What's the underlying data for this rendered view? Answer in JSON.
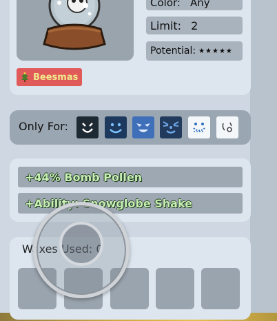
{
  "stats": {
    "color": {
      "label": "Color:",
      "value": "Any"
    },
    "limit": {
      "label": "Limit:",
      "value": "2"
    },
    "potential": {
      "label": "Potential:",
      "value": "★★★★★"
    }
  },
  "tag": {
    "label": "Beesmas",
    "color": "#e05a5a",
    "text_color": "#f0e98a"
  },
  "only_for": {
    "label": "Only For:",
    "bees": [
      {
        "name": "vicious-bee"
      },
      {
        "name": "bubble-bee"
      },
      {
        "name": "cobalt-bee"
      },
      {
        "name": "tabby-bee"
      },
      {
        "name": "festive-bee"
      },
      {
        "name": "photon-bee"
      }
    ]
  },
  "abilities": [
    "+44% Bomb Pollen",
    "+Ability: Snowglobe Shake"
  ],
  "waxes": {
    "label": "Waxes Used: 0",
    "slots": 5
  },
  "colors": {
    "panel": "#dde6ef",
    "stat_bg": "#a9b3bd",
    "ability_text": "#c8f0b4"
  }
}
